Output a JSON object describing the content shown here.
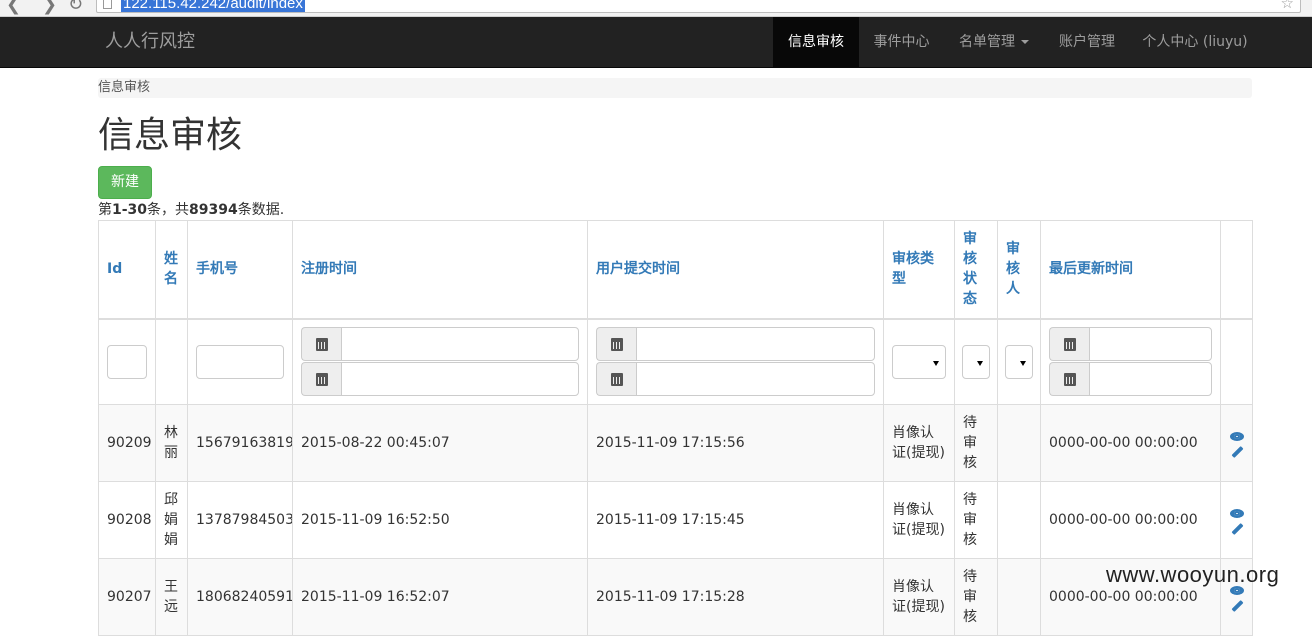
{
  "browser": {
    "url": "122.115.42.242/audit/index",
    "back_glyph": "❮",
    "forward_glyph": "❯",
    "reload_glyph": "↻",
    "star_glyph": "☆"
  },
  "navbar": {
    "brand": "人人行风控",
    "items": [
      {
        "label": "信息审核",
        "active": true
      },
      {
        "label": "事件中心",
        "active": false
      },
      {
        "label": "名单管理",
        "active": false,
        "dropdown": true
      },
      {
        "label": "账户管理",
        "active": false
      },
      {
        "label": "个人中心 (liuyu)",
        "active": false
      }
    ]
  },
  "breadcrumb": "信息审核",
  "page_title": "信息审核",
  "new_button": "新建",
  "summary": {
    "prefix": "第",
    "range": "1-30",
    "mid": "条，共",
    "total": "89394",
    "suffix": "条数据."
  },
  "table": {
    "headers": {
      "id": "Id",
      "name": "姓名",
      "phone": "手机号",
      "register_time": "注册时间",
      "submit_time": "用户提交时间",
      "audit_type": "审核类型",
      "audit_status": "审核状态",
      "auditor": "审核人",
      "updated_time": "最后更新时间"
    },
    "rows": [
      {
        "id": "90209",
        "name": "林丽",
        "phone": "15679163819",
        "register_time": "2015-08-22 00:45:07",
        "submit_time": "2015-11-09 17:15:56",
        "audit_type": "肖像认证(提现)",
        "audit_status": "待审核",
        "auditor": "",
        "updated_time": "0000-00-00 00:00:00"
      },
      {
        "id": "90208",
        "name": "邱娟娟",
        "phone": "13787984503",
        "register_time": "2015-11-09 16:52:50",
        "submit_time": "2015-11-09 17:15:45",
        "audit_type": "肖像认证(提现)",
        "audit_status": "待审核",
        "auditor": "",
        "updated_time": "0000-00-00 00:00:00"
      },
      {
        "id": "90207",
        "name": "王远",
        "phone": "18068240591",
        "register_time": "2015-11-09 16:52:07",
        "submit_time": "2015-11-09 17:15:28",
        "audit_type": "肖像认证(提现)",
        "audit_status": "待审核",
        "auditor": "",
        "updated_time": "0000-00-00 00:00:00"
      }
    ],
    "row_actions": [
      "eye-icon",
      "pencil-icon"
    ]
  },
  "watermark": "www.wooyun.org",
  "colors": {
    "navbar": "#222222",
    "active_nav": "#080808",
    "link": "#337ab7",
    "success": "#5cb85c",
    "url_highlight": "#3875d7"
  }
}
